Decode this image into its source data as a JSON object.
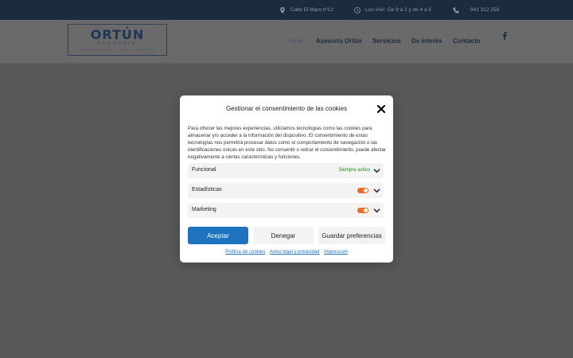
{
  "topbar": {
    "address": "Calle El Maro nº12",
    "hours": "Lun-Vier: De 9 a 2 y de 4 a 6",
    "phone": "941 312 258",
    "icons": [
      "location-pin-icon",
      "clock-icon",
      "phone-icon"
    ]
  },
  "logo": {
    "name": "ORTÚN",
    "subtitle": "ASESORÍA",
    "tagline": "CONTABILIDAD · FISCAL · LABORAL"
  },
  "nav": {
    "items": [
      "Inicio",
      "Asesoría Ortún",
      "Servicios",
      "De interés",
      "Contacto"
    ],
    "active": "Inicio",
    "social_icon": "facebook-icon"
  },
  "consent": {
    "title": "Gestionar el consentimiento de las cookies",
    "description": "Para ofrecer las mejores experiencias, utilizamos tecnologías como las cookies para almacenar y/o acceder a la información del dispositivo. El consentimiento de estas tecnologías nos permitirá procesar datos como el comportamiento de navegación o las identificaciones únicas en este sitio. No consentir o retirar el consentimiento, puede afectar negativamente a ciertas características y funciones.",
    "categories": [
      {
        "label": "Funcional",
        "status": "Siempre activo"
      },
      {
        "label": "Estadísticas"
      },
      {
        "label": "Marketing"
      }
    ],
    "buttons": {
      "accept": "Aceptar",
      "deny": "Denegar",
      "preferences": "Guardar preferencias"
    },
    "links": [
      "Política de cookies",
      "Aviso legal y privacidad",
      "Impressum"
    ]
  },
  "colors": {
    "topbar_bg": "#1b2b40",
    "primary": "#1e73be",
    "toggle_on": "#f06c25",
    "always_active": "#1f8a1f"
  }
}
